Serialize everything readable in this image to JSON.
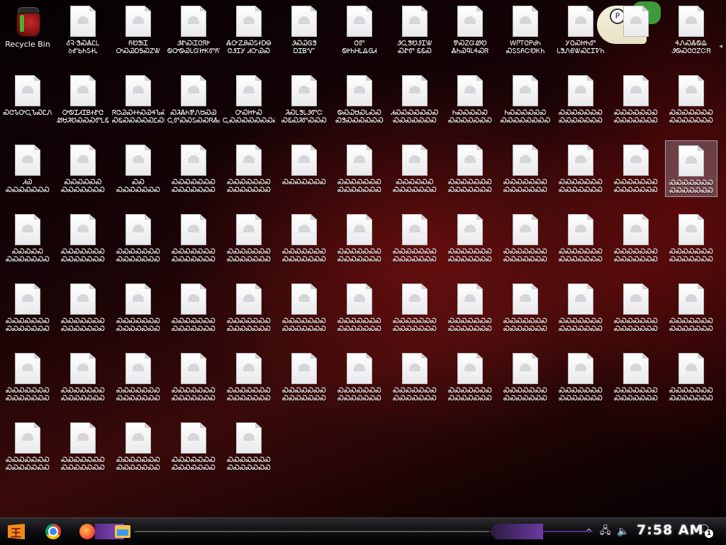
{
  "desktop": {
    "recycle_bin": {
      "label": "Recycle Bin"
    },
    "selected_index": 37,
    "columns": 12,
    "files": [
      [
        "ᎴᎸ·ᏕᏍᏜᏝᏞ",
        "ꝺᎹᏏᏂᏚᏐᏓ"
      ],
      [
        "ᏲᏬᏕᎥᏆ",
        "ᎤᏍᏊᎠᎦᏍᏃᏔ"
      ],
      [
        "ᏭᏑᏍᎥᏆᏣᏒᎨ",
        "ᏫᎤᏫᏯᏓᏳᏥᏦᏛᏲᏔ"
      ],
      [
        "ᏜᏅᏃᎯᏍᏚᏐᎠᎾ",
        "ᏣᏭᏆᎩ ᏗᏅᏯᏍ"
      ],
      [
        "ᏭᏍᏇᎶᏕ",
        "ᎠᏆᏴᏉ"
      ],
      [
        "ᏣᏛ",
        "ᏫᎨᏂᎻᏞᎲᎶᏗ"
      ],
      [
        "ᏭᏩᏕᏬᏭᏆᏔ",
        "ᏍᏑᏛ ᏋᏋᏍ"
      ],
      [
        "ᏈᏍᏃᏳᏪᏬ",
        "ᏜᏂᏯᏄᏓᏎᏍᏒ"
      ],
      [
        "ᎳᎵᎢᏣᏢᏧᏂ",
        "ᏍᏚᏚᏲᏨᏬᏦᏂ"
      ],
      [
        "ᎩᏣᏍᏥᏂᏛ",
        "ᏓᏕᏁᏮᏔᏍᏝᏆᏤᏂ"
      ],
      [
        "",
        ""
      ],
      [
        "ᏎᏁᏍᏜᏫᎲ",
        "ᏭᏫᏍᏣᏣᏃᏨᏒ"
      ],
      [
        "ᏍᏣᏖᎤᏩᏖᏍᏝᏁ",
        ""
      ],
      [
        "ᎤᏫᏆᏗᏆᏴᏐᏑᏣ",
        "ᏪᏌᏘᏬᏍᏍᏍᏛᏞᏋ"
      ],
      [
        "ᏒᏣᏊᏍᏐᏐᏍᏯᏎᏖᏍ",
        "ᏍᏋᏍᏍᏍᏍᏍᏝᏍᏦ"
      ],
      [
        "ᏍᏘᏜᏂᏈᏁᏌᏍᏯ",
        "ᏩᏛᏍᏍᏚᏍᏍᏒᏜᏍ"
      ],
      [
        "ᎤᏍᏥᎨᏍ",
        "ᏩᏍᏍᏍᏍᏍᏍᏍᏍ"
      ],
      [
        "ᏘᏍᏞᏕᏓᏭᏛᏨ",
        "ᏍᏋᏍᏘᏛᏍᏍᏍ"
      ],
      [
        "ᏫᏍᏇᏌᏍᏓᏍᏍ",
        "ᏍᏕᏍᏍᏍᏍᏍᏍ"
      ],
      [
        "ᏗᏍᏍᏍᏍᏍᏍᏍ",
        "ᏍᏍᏍᏍᏍᏍᏍ"
      ],
      [
        "ᏂᏍᏍᏍᏍᏍ",
        "ᏍᏍᏍᏍᏍᏍᏍ"
      ],
      [
        "ᏂᏍᏍᏍᏍᏍᏍ",
        "ᏍᏍᏍᏍᏍᏍᏍᏍ"
      ],
      [
        "ᏍᏍᏍᏍᏍᏍᏍ",
        "ᏍᏍᏍᏍᏍᏍᏍ"
      ],
      [
        "ᏍᏍᏍᏍᏍᏍᏍ",
        "ᏍᏍᏍᏍᏍᏍᏍ"
      ],
      [
        "ᏍᏍᏍᏍᏍᏍᏍ",
        "ᏍᏍᏍᏍᏍᏍᏍ"
      ],
      [
        "ᏗᏯ",
        "ᏍᏍᏍᏍᏍᏍᏍ"
      ],
      [
        "ᏍᏍᏍᏍᏍᏍ",
        "ᏍᏍᏍᏍᏍᏍᏍ"
      ],
      [
        "ᏍᏍ",
        "ᏍᏍᏍᏍᏍᏍᏍ"
      ],
      [
        "ᏍᏍᏍᏍᏍᏍᏍ",
        "ᏍᏍᏍᏍᏍᏍᏍ"
      ],
      [
        "ᏍᏍᏍᏍᏍᏍᏍ",
        "ᏍᏍᏍᏍᏍᏍᏍ"
      ],
      [
        "ᏍᏍᏍᏍᏍᏍᏍ",
        ""
      ],
      [
        "ᏍᏍᏍᏍᏍᏍᏍ",
        "ᏍᏍᏍᏍᏍᏍᏍ"
      ],
      [
        "ᏍᏍᏍᏍᏍᏍ",
        "ᏍᏍᏍᏍᏍᏍᏍ"
      ],
      [
        "ᏍᏍᏍᏍᏍᏍᏍ",
        "ᏍᏍᏍᏍᏍᏍᏍ"
      ],
      [
        "ᏍᏍᏍᏍᏍᏍᏍ",
        "ᏍᏍᏍᏍᏍᏍᏍ"
      ],
      [
        "ᏍᏍᏍᏍᏍᏍᏍ",
        "ᏍᏍᏍᏍᏍᏍᏍ"
      ],
      [
        "ᏍᏍᏍᏍᏍᏍᏍ",
        "ᏍᏍᏍᏍᏍᏍᏍ"
      ],
      [
        "ᏍᏍᏍᏍᏍᏍᏍ",
        "ᏍᏍᏍᏍᏍᏍᏍ"
      ],
      [
        "ᏍᏍᏍᏍᏍ",
        "ᏍᏍᏍᏍᏍᏍᏍ"
      ],
      [
        "ᏍᏍᏍᏍᏍᏍᏍ",
        "ᏍᏍᏍᏍᏍᏍᏍ"
      ],
      [
        "ᏍᏍᏍᏍᏍᏍᏍ",
        "ᏍᏍᏍᏍᏍᏍᏍ"
      ],
      [
        "ᏍᏍᏍᏍᏍᏍᏍ",
        "ᏍᏍᏍᏍᏍᏍᏍ"
      ],
      [
        "ᏍᏍᏍᏍᏍᏍᏍ",
        "ᏍᏍᏍᏍᏍᏍᏍ"
      ],
      [
        "ᏍᏍᏍᏍᏍᏍᏍ",
        "ᏍᏍᏍᏍᏍᏍᏍ"
      ],
      [
        "ᏍᏍᏍᏍᏍᏍᏍ",
        "ᏍᏍᏍᏍᏍᏍᏍ"
      ],
      [
        "ᏍᏍᏍᏍᏍᏍᏍ",
        "ᏍᏍᏍᏍᏍᏍᏍ"
      ],
      [
        "ᏍᏍᏍᏍᏍᏍᏍ",
        "ᏍᏍᏍᏍᏍᏍᏍ"
      ],
      [
        "ᏍᏍᏍᏍᏍᏍᏍ",
        "ᏍᏍᏍᏍᏍᏍᏍ"
      ],
      [
        "ᏍᏍᏍᏍᏍᏍᏍ",
        "ᏍᏍᏍᏍᏍᏍᏍ"
      ],
      [
        "ᏍᏍᏍᏍᏍᏍᏍ",
        "ᏍᏍᏍᏍᏍᏍᏍ"
      ],
      [
        "ᏍᏍᏍᏍᏍᏍᏍ",
        "ᏍᏍᏍᏍᏍᏍᏍ"
      ],
      [
        "ᏍᏍᏍᏍᏍᏍᏍ",
        "ᏍᏍᏍᏍᏍᏍᏍ"
      ],
      [
        "ᏍᏍᏍᏍᏍᏍᏍ",
        "ᏍᏍᏍᏍᏍᏍᏍ"
      ],
      [
        "ᏍᏍᏍᏍᏍᏍᏍ",
        "ᏍᏍᏍᏍᏍᏍᏍ"
      ],
      [
        "ᏍᏍᏍᏍᏍᏍᏍ",
        "ᏍᏍᏍᏍᏍᏍᏍ"
      ],
      [
        "ᏍᏍᏍᏍᏍᏍᏍ",
        "ᏍᏍᏍᏍᏍᏍᏍ"
      ],
      [
        "ᏍᏍᏍᏍᏍᏍᏍ",
        "ᏍᏍᏍᏍᏍᏍᏍ"
      ],
      [
        "ᏍᏍᏍᏍᏍᏍᏍ",
        "ᏍᏍᏍᏍᏍᏍᏍ"
      ],
      [
        "ᏍᏍᏍᏍᏍᏍᏍ",
        "ᏍᏍᏍᏍᏍᏍᏍ"
      ],
      [
        "ᏍᏍᏍᏍᏍᏍᏍ",
        "ᏍᏍᏍᏍᏍᏍᏍ"
      ],
      [
        "ᏍᏍᏍᏍᏍᏍᏍ",
        "ᏍᏍᏍᏍᏍᏍᏍ"
      ],
      [
        "ᏍᏍᏍᏍᏍᏍᏍ",
        "ᏍᏍᏍᏍᏍᏍᏍ"
      ],
      [
        "ᏍᏍᏍᏍᏍᏍᏍ",
        "ᏍᏍᏍᏍᏍᏍᏍ"
      ],
      [
        "ᏍᏍᏍᏍᏍᏍᏍ",
        "ᏍᏍᏍᏍᏍᏍᏍ"
      ],
      [
        "ᏍᏍᏍᏍᏍᏍᏍ",
        "ᏍᏍᏍᏍᏍᏍᏍ"
      ],
      [
        "ᏍᏍᏍᏍᏍᏍᏍ",
        "ᏍᏍᏍᏍᏍᏍᏍ"
      ],
      [
        "ᏍᏍᏍᏍᏍᏍᏍ",
        "ᏍᏍᏍᏍᏍᏍᏍ"
      ],
      [
        "ᏍᏍᏍᏍᏍᏍᏍ",
        "ᏍᏍᏍᏍᏍᏍᏍ"
      ],
      [
        "ᏍᏍᏍᏍᏍᏍᏍ",
        "ᏍᏍᏍᏍᏍᏍᏍ"
      ],
      [
        "ᏍᏍᏍᏍᏍᏍᏍ",
        "ᏍᏍᏍᏍᏍᏍᏍ"
      ],
      [
        "ᏍᏍᏍᏍᏍᏍᏍ",
        "ᏍᏍᏍᏍᏍᏍᏍ"
      ],
      [
        "ᏍᏍᏍᏍᏍᏍᏍ",
        "ᏍᏍᏍᏍᏍᏍᏍ"
      ],
      [
        "ᏍᏍᏍᏍᏍᏍᏍ",
        "ᏍᏍᏍᏍᏍᏍᏍ"
      ],
      [
        "ᏍᏍᏍᏍᏍᏍᏍ",
        "ᏍᏍᏍᏍᏍᏍᏍ"
      ],
      [
        "ᏍᏍᏍᏍᏍᏍᏍ",
        "ᏍᏍᏍᏍᏍᏍᏍ"
      ],
      [
        "ᏍᏍᏍᏍᏍᏍᏍ",
        "ᏍᏍᏍᏍᏍᏍᏍ"
      ],
      [
        "ᏍᏍᏍᏍᏍᏍᏍ",
        "ᏍᏍᏍᏍᏍᏍᏍ"
      ],
      [
        "ᏍᏍᏍᏍᏍᏍᏍ",
        "ᏍᏍᏍᏍᏍᏍᏍ"
      ],
      [
        "ᏍᏍᏍᏍᏍᏍᏍ",
        "ᏍᏍᏍᏍᏍᏍᏍ"
      ],
      [
        "ᏍᏍᏍᏍᏍᏍᏍ",
        "ᏍᏍᏍᏍᏍᏍᏍ"
      ],
      [
        "ᏍᏍᏍᏍᏍᏍᏍ",
        "ᏍᏍᏍᏍᏍᏍᏍ"
      ],
      [
        "ᏍᏍᏍᏍᏍᏍᏍ",
        "ᏍᏍᏍᏍᏍᏍᏍ"
      ]
    ]
  },
  "taskbar": {
    "start_icon": "start-logo",
    "pinned": [
      {
        "name": "chrome",
        "icon": "chrome-icon"
      },
      {
        "name": "firefox",
        "icon": "firefox-icon"
      },
      {
        "name": "file-explorer",
        "icon": "folder-icon"
      }
    ],
    "tray": {
      "chevron": "^",
      "network_icon": "network-icon",
      "volume_icon": "volume-icon",
      "clock": "7:58 AM",
      "notification_count": "1"
    }
  },
  "colors": {
    "accent_purple": "#6a3aa0",
    "start_orange": "#f08c1a"
  }
}
